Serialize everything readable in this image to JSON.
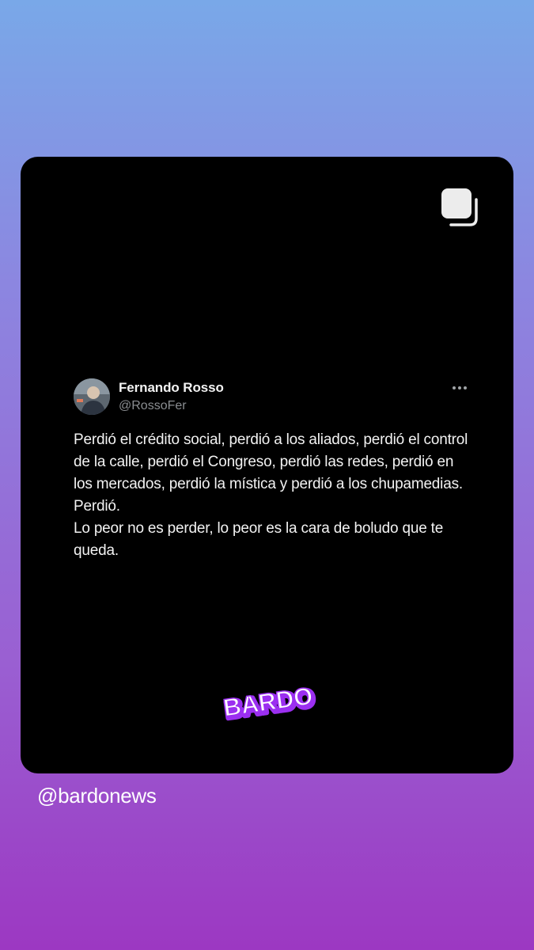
{
  "tweet": {
    "author_name": "Fernando Rosso",
    "author_handle": "@RossoFer",
    "text_paragraph_1": "Perdió el crédito social, perdió a los aliados, perdió el control de la calle, perdió el Congreso, perdió las redes, perdió en los mercados, perdió la mística y perdió a los chupamedias. Perdió.",
    "text_paragraph_2": "Lo peor no es perder, lo peor es la cara de boludo que te queda."
  },
  "brand": {
    "logo_text": "BARDO",
    "logo_color": "#ffffff",
    "logo_shadow_color": "#9b2ff0"
  },
  "footer": {
    "account_handle": "@bardonews"
  },
  "icons": {
    "carousel": "carousel-icon",
    "more": "more-options-icon"
  },
  "colors": {
    "card_background": "#000000",
    "gradient_top": "#79a8e8",
    "gradient_bottom": "#9c38c2"
  }
}
